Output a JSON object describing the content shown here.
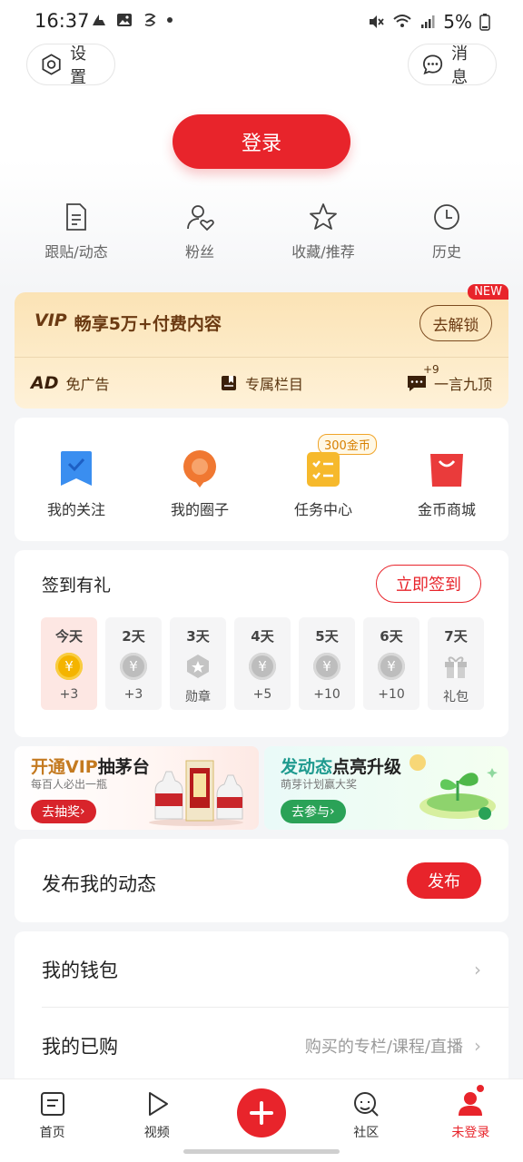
{
  "status_bar": {
    "time": "16:37",
    "battery": "5%"
  },
  "header": {
    "settings_label": "设置",
    "messages_label": "消息",
    "login_label": "登录"
  },
  "quick_links": [
    {
      "label": "跟贴/动态",
      "icon": "document-icon"
    },
    {
      "label": "粉丝",
      "icon": "user-heart-icon"
    },
    {
      "label": "收藏/推荐",
      "icon": "star-icon"
    },
    {
      "label": "历史",
      "icon": "clock-icon"
    }
  ],
  "vip": {
    "badge": "NEW",
    "mark": "VIP",
    "title": "畅享5万+付费内容",
    "unlock_label": "去解锁",
    "perks": [
      {
        "mark": "AD",
        "label": "免广告"
      },
      {
        "label": "专属栏目"
      },
      {
        "sup": "+9",
        "label": "一言九顶"
      }
    ]
  },
  "features": [
    {
      "label": "我的关注",
      "icon": "bookmark-icon"
    },
    {
      "label": "我的圈子",
      "icon": "chat-circle-icon"
    },
    {
      "label": "任务中心",
      "icon": "task-list-icon",
      "badge": "300金币"
    },
    {
      "label": "金币商城",
      "icon": "shopping-bag-icon"
    }
  ],
  "sign_in": {
    "title": "签到有礼",
    "button_label": "立即签到",
    "days": [
      {
        "label": "今天",
        "reward": "+3",
        "icon": "yen-coin-gold-icon"
      },
      {
        "label": "2天",
        "reward": "+3",
        "icon": "yen-coin-gray-icon"
      },
      {
        "label": "3天",
        "reward": "勋章",
        "icon": "medal-icon"
      },
      {
        "label": "4天",
        "reward": "+5",
        "icon": "yen-coin-gray-icon"
      },
      {
        "label": "5天",
        "reward": "+10",
        "icon": "yen-coin-gray-icon"
      },
      {
        "label": "6天",
        "reward": "+10",
        "icon": "yen-coin-gray-icon"
      },
      {
        "label": "7天",
        "reward": "礼包",
        "icon": "gift-icon"
      }
    ]
  },
  "banners": {
    "left": {
      "title_a": "开通VIP",
      "title_b": "抽茅台",
      "subtitle": "每百人必出一瓶",
      "button": "去抽奖"
    },
    "right": {
      "title_a": "发动态",
      "title_b": "点亮升级",
      "subtitle": "萌芽计划赢大奖",
      "button": "去参与"
    }
  },
  "publish": {
    "title": "发布我的动态",
    "button_label": "发布"
  },
  "list": [
    {
      "label": "我的钱包",
      "value": ""
    },
    {
      "label": "我的已购",
      "value": "购买的专栏/课程/直播"
    }
  ],
  "tab_bar": [
    {
      "label": "首页",
      "icon": "home-icon"
    },
    {
      "label": "视频",
      "icon": "play-icon"
    },
    {
      "label": "",
      "icon": "plus-icon"
    },
    {
      "label": "社区",
      "icon": "community-icon"
    },
    {
      "label": "未登录",
      "icon": "profile-icon",
      "active": true
    }
  ],
  "colors": {
    "brand_red": "#e8242b",
    "vip_brown": "#6b3a12",
    "gold": "#f4b400"
  }
}
